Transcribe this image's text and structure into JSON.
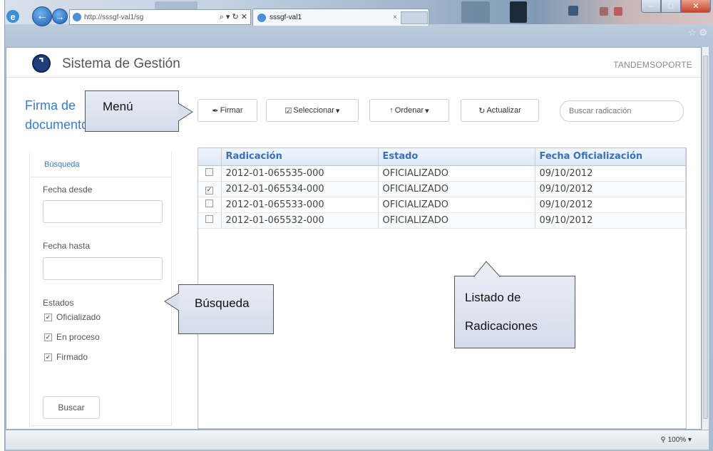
{
  "browser": {
    "address": "http://sssgf-val1/sg",
    "address_controls": "⌕ ▾ ↻ ✕",
    "tab_title": "sssgf-val1",
    "tab_close": "×",
    "zoom": "100%"
  },
  "app": {
    "name": "Sistema de Gestión",
    "user": "TANDEMSOPORTE"
  },
  "page": {
    "title_line1": "Firma de",
    "title_line2": "documentos"
  },
  "toolbar": {
    "firmar": "Firmar",
    "seleccionar": "Seleccionar",
    "ordenar": "Ordenar",
    "actualizar": "Actualizar",
    "search_placeholder": "Buscar radicación"
  },
  "sidebar": {
    "header": "Búsqueda",
    "fecha_desde": "Fecha desde",
    "fecha_hasta": "Fecha hasta",
    "estados": "Estados",
    "checks": [
      {
        "label": "Oficializado",
        "checked": true
      },
      {
        "label": "En proceso",
        "checked": true
      },
      {
        "label": "Firmado",
        "checked": true
      }
    ],
    "buscar": "Buscar"
  },
  "table": {
    "columns": [
      "Radicación",
      "Estado",
      "Fecha Oficialización"
    ],
    "rows": [
      {
        "checked": false,
        "radicacion": "2012-01-065535-000",
        "estado": "OFICIALIZADO",
        "fecha": "09/10/2012"
      },
      {
        "checked": true,
        "radicacion": "2012-01-065534-000",
        "estado": "OFICIALIZADO",
        "fecha": "09/10/2012"
      },
      {
        "checked": false,
        "radicacion": "2012-01-065533-000",
        "estado": "OFICIALIZADO",
        "fecha": "09/10/2012"
      },
      {
        "checked": false,
        "radicacion": "2012-01-065532-000",
        "estado": "OFICIALIZADO",
        "fecha": "09/10/2012"
      }
    ]
  },
  "callouts": {
    "menu": "Menú",
    "busqueda": "Búsqueda",
    "listado_line1": "Listado de",
    "listado_line2": "Radicaciones"
  },
  "colors": {
    "accent": "#3a7bc8",
    "callout_fill": "#d9e0ee"
  }
}
